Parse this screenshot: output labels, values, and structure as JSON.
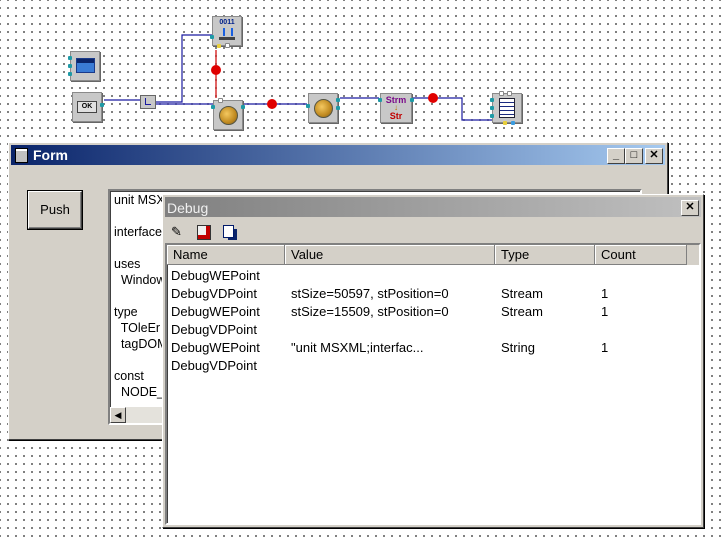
{
  "form_window": {
    "title": "Form",
    "push_button": "Push",
    "memo_lines": [
      "unit MSX",
      "",
      "interface",
      "",
      "uses",
      "  Window",
      "",
      "type",
      "  TOleEr",
      "  tagDOM",
      "",
      "const",
      "  NODE_"
    ],
    "scroll_left": "◀",
    "minimize": "_",
    "maximize": "□",
    "close": "✕"
  },
  "debug_window": {
    "title": "Debug",
    "close": "✕",
    "columns": [
      "Name",
      "Value",
      "Type",
      "Count"
    ],
    "rows": [
      {
        "name": "DebugWEPoint",
        "value": "",
        "type": "",
        "count": ""
      },
      {
        "name": "DebugVDPoint",
        "value": "stSize=50597, stPosition=0",
        "type": "Stream",
        "count": "1"
      },
      {
        "name": "DebugWEPoint",
        "value": "stSize=15509, stPosition=0",
        "type": "Stream",
        "count": "1"
      },
      {
        "name": "DebugVDPoint",
        "value": "",
        "type": "",
        "count": ""
      },
      {
        "name": "DebugWEPoint",
        "value": "\"unit MSXML;interfac...",
        "type": "String",
        "count": "1"
      },
      {
        "name": "DebugVDPoint",
        "value": "",
        "type": "",
        "count": ""
      }
    ]
  },
  "schematic": {
    "load_label": "0011",
    "ok_label": "OK",
    "strm_label": "Strm",
    "str_label": "Str",
    "wire_color": "#1a1aa0",
    "point_color": "#e00000"
  }
}
